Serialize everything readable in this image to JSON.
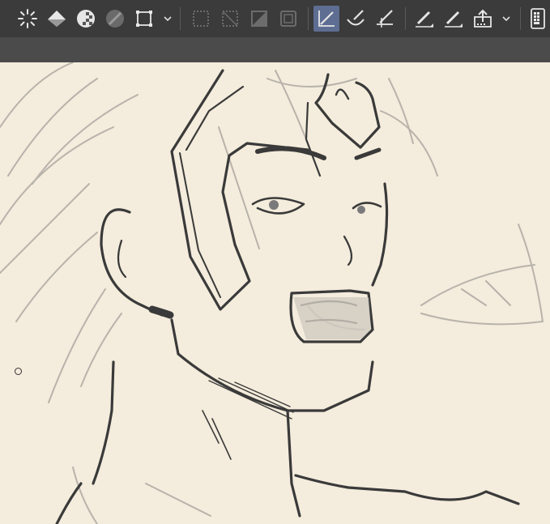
{
  "toolbar": {
    "tools": [
      {
        "name": "selection-spinner-icon"
      },
      {
        "name": "fill-bucket-icon"
      },
      {
        "name": "checker-fill-icon"
      },
      {
        "name": "slash-circle-icon"
      },
      {
        "name": "transform-box-icon"
      },
      {
        "name": "chevron-down-icon"
      },
      {
        "name": "dotted-selection-icon"
      },
      {
        "name": "invert-selection-icon"
      },
      {
        "name": "diagonal-fill-icon"
      },
      {
        "name": "selection-frame-icon"
      },
      {
        "name": "vector-pen-icon",
        "active": true
      },
      {
        "name": "brush-bowl-icon"
      },
      {
        "name": "ruler-pen-icon"
      },
      {
        "name": "pen-pressure-icon"
      },
      {
        "name": "pen-stroke-icon"
      },
      {
        "name": "layer-upload-icon"
      },
      {
        "name": "chevron-down-icon"
      },
      {
        "name": "keypad-device-icon"
      }
    ],
    "accent_color": "#5e6d92",
    "bar_color": "#3b3b3b"
  },
  "canvas": {
    "paper_color": "#f4ecdc",
    "ink_color": "#3a3a3a",
    "sketch_color": "#b7b2aa"
  }
}
